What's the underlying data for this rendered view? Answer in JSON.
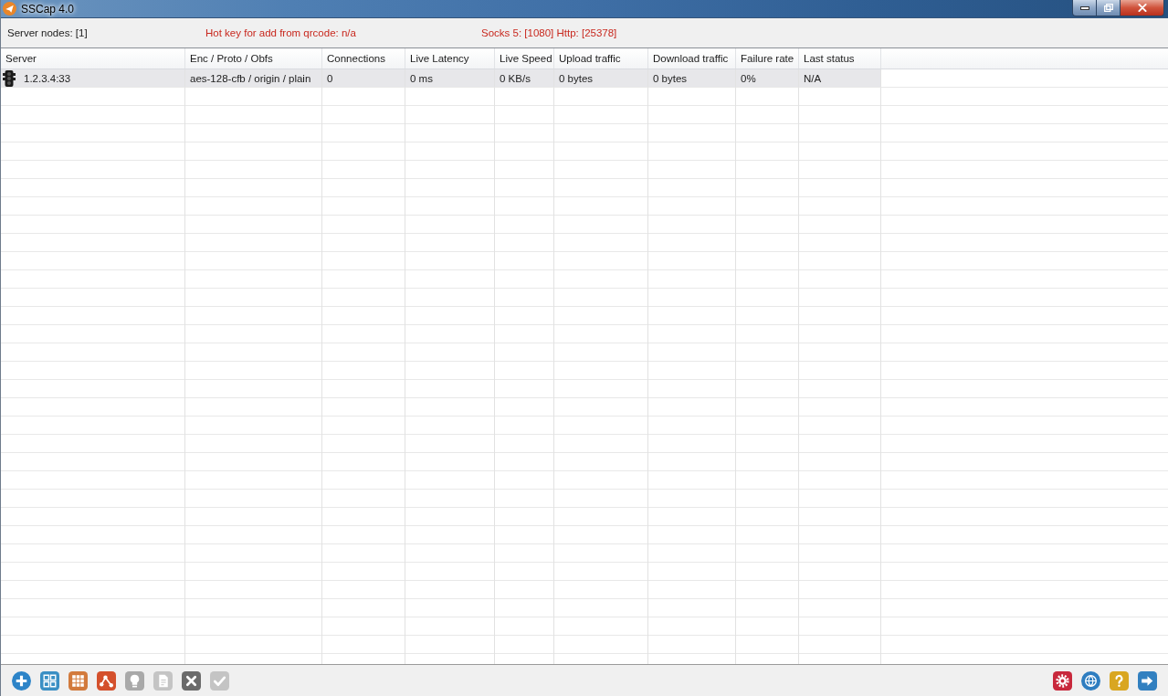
{
  "window": {
    "title": "SSCap 4.0"
  },
  "info_bar": {
    "server_nodes": "Server nodes: [1]",
    "hotkey": "Hot key for add from qrcode: n/a",
    "ports": "Socks 5: [1080] Http: [25378]"
  },
  "table": {
    "columns": [
      "Server",
      "Enc / Proto / Obfs",
      "Connections",
      "Live Latency",
      "Live Speed",
      "Upload traffic",
      "Download traffic",
      "Failure rate",
      "Last status"
    ],
    "rows": [
      {
        "selected": true,
        "cells": [
          "1.2.3.4:33",
          "aes-128-cfb / origin / plain",
          "0",
          "0 ms",
          "0 KB/s",
          "0 bytes",
          "0 bytes",
          "0%",
          "N/A"
        ]
      }
    ]
  },
  "toolbar": {
    "left": [
      {
        "disabled": false
      },
      {
        "disabled": false
      },
      {
        "disabled": false
      },
      {
        "disabled": false
      },
      {
        "disabled": true
      },
      {
        "disabled": true
      },
      {
        "disabled": false
      },
      {
        "disabled": true
      }
    ],
    "right": [
      {
        "disabled": false
      },
      {
        "disabled": false
      },
      {
        "disabled": false
      },
      {
        "disabled": false
      }
    ]
  }
}
